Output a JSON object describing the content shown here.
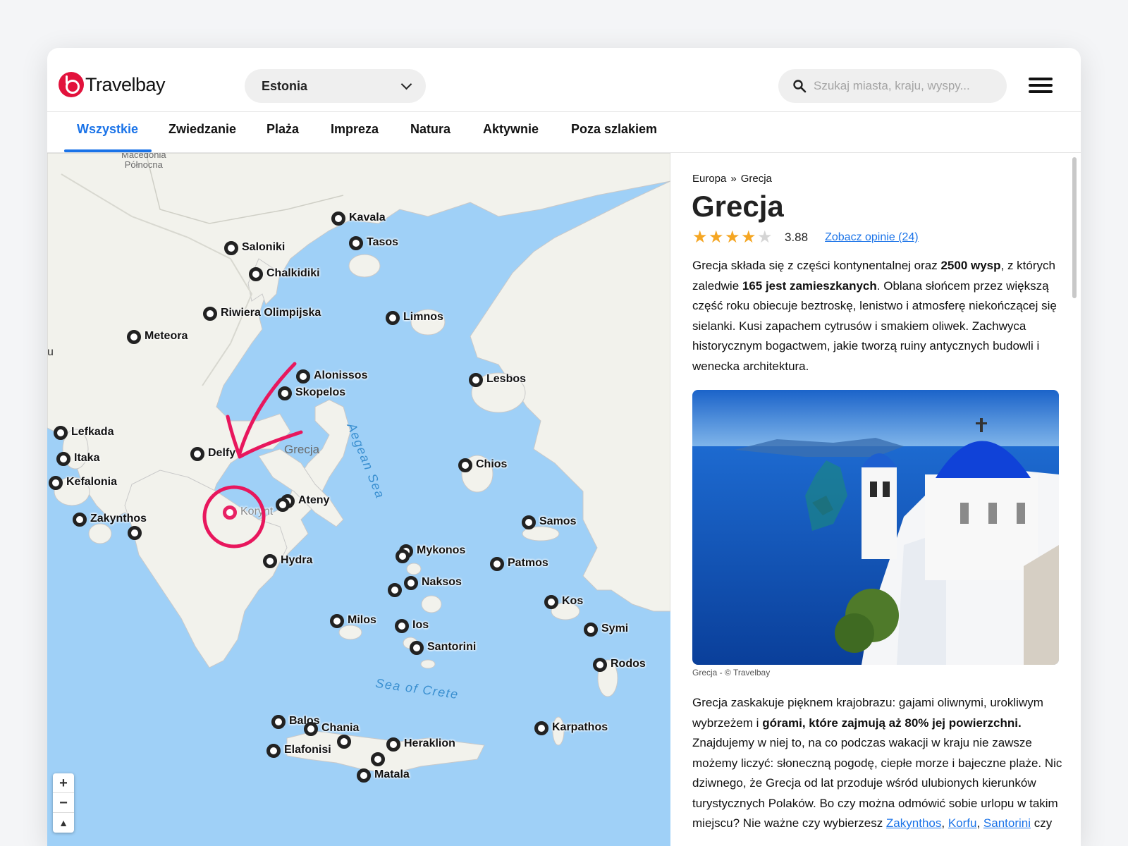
{
  "brand": {
    "name": "Travelbay",
    "accent": "#e2123c"
  },
  "header": {
    "country_selected": "Estonia",
    "search_placeholder": "Szukaj miasta, kraju, wyspy...",
    "menu_icon": "hamburger-icon"
  },
  "tabs": [
    {
      "label": "Wszystkie",
      "active": true
    },
    {
      "label": "Zwiedzanie"
    },
    {
      "label": "Plaża"
    },
    {
      "label": "Impreza"
    },
    {
      "label": "Natura"
    },
    {
      "label": "Aktywnie"
    },
    {
      "label": "Poza szlakiem"
    }
  ],
  "map": {
    "region_labels": {
      "macedonia": "Macedonia\nPółnocna",
      "greece": "Grecja",
      "partial": "u"
    },
    "sea_labels": {
      "aegean": "Aegean Sea",
      "crete": "Sea of Crete"
    },
    "zoom": {
      "plus": "+",
      "minus": "−",
      "compass": "▲"
    },
    "places": [
      "Kavala",
      "Tasos",
      "Saloniki",
      "Chalkidiki",
      "Riwiera Olimpijska",
      "Limnos",
      "Meteora",
      "Alonissos",
      "Skopelos",
      "Lesbos",
      "Lefkada",
      "Itaka",
      "Delfy",
      "Kefalonia",
      "Chios",
      "Ateny",
      "Korynt",
      "Zakynthos",
      "Samos",
      "Mykonos",
      "Hydra",
      "Patmos",
      "Naksos",
      "Kos",
      "Milos",
      "Ios",
      "Symi",
      "Santorini",
      "Rodos",
      "Balos",
      "Chania",
      "Karpathos",
      "Heraklion",
      "Elafonisi",
      "Matala"
    ]
  },
  "detail": {
    "breadcrumb": [
      "Europa",
      "Grecja"
    ],
    "breadcrumb_sep": "»",
    "title": "Grecja",
    "rating": 3.88,
    "rating_text": "3.88",
    "stars_filled": 4,
    "stars_total": 5,
    "reviews_link": "Zobacz opinie (24)",
    "desc1": [
      {
        "t": "Grecja składa się z części kontynentalnej oraz "
      },
      {
        "t": "2500 wysp",
        "b": true
      },
      {
        "t": ", z których zaledwie "
      },
      {
        "t": "165 jest zamieszkanych",
        "b": true
      },
      {
        "t": ". Oblana słońcem przez większą część roku obiecuje beztroskę, lenistwo i atmosferę niekończącej się sielanki. Kusi zapachem cytrusów i smakiem oliwek. Zachwyca historycznym bogactwem, jakie tworzą ruiny antycznych budowli i wenecka architektura."
      }
    ],
    "photo_caption": "Grecja - © Travelbay",
    "desc2": [
      {
        "t": "Grecja zaskakuje pięknem krajobrazu: gajami oliwnymi, urokliwym wybrzeżem i "
      },
      {
        "t": "górami, które zajmują aż 80% jej powierzchni.",
        "b": true
      },
      {
        "t": " Znajdujemy w niej to, na co podczas wakacji w kraju nie zawsze możemy liczyć: słoneczną pogodę, ciepłe morze i bajeczne plaże. Nic dziwnego, że Grecja od lat przoduje wśród ulubionych kierunków turystycznych Polaków. Bo czy można odmówić sobie urlopu w takim miejscu? Nie ważne czy wybierzesz "
      },
      {
        "t": "Zakynthos",
        "link": true
      },
      {
        "t": ", "
      },
      {
        "t": "Korfu",
        "link": true
      },
      {
        "t": ", "
      },
      {
        "t": "Santorini",
        "link": true
      },
      {
        "t": " czy"
      }
    ]
  },
  "colors": {
    "sea": "#9fd0f7",
    "land": "#f2f2ec",
    "link": "#1a73e8",
    "star": "#f5a623",
    "annotation": "#e8175d"
  }
}
